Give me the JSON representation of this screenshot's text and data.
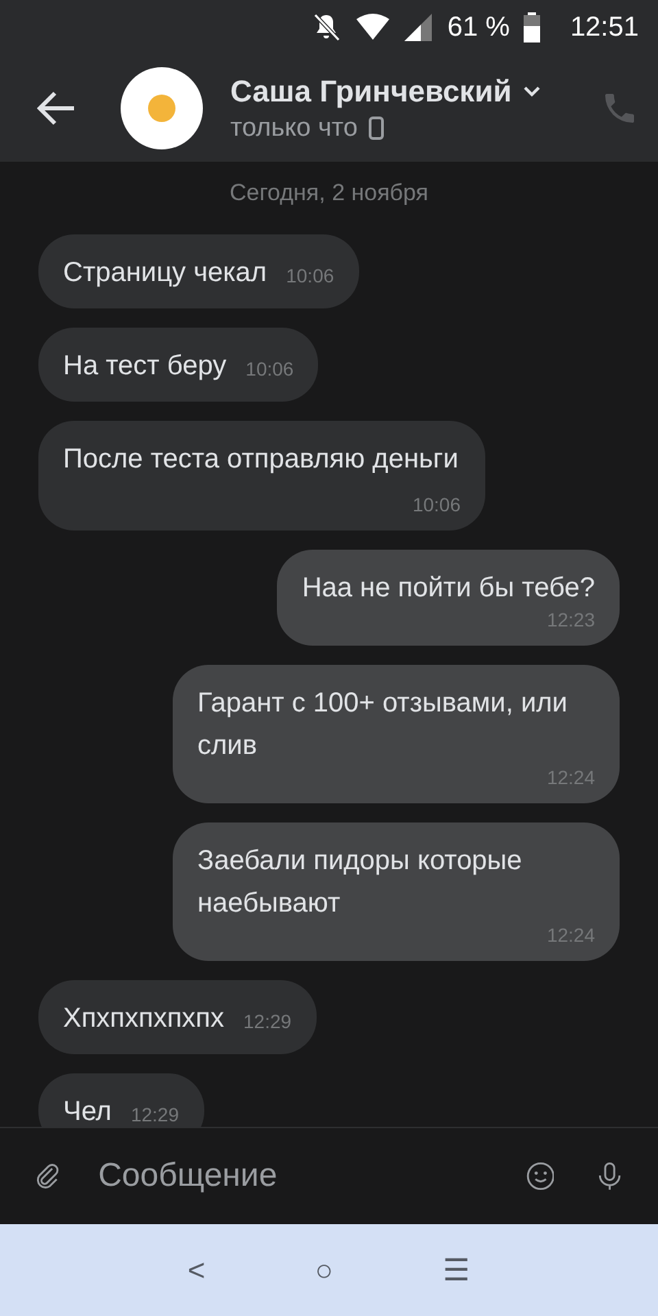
{
  "status_bar": {
    "battery": "61 %",
    "time": "12:51"
  },
  "header": {
    "name": "Саша Гринчевский",
    "status": "только что"
  },
  "date": "Сегодня, 2 ноября",
  "messages": [
    {
      "kind": "in",
      "text": "Страницу чекал",
      "time": "10:06"
    },
    {
      "kind": "in",
      "text": "На тест беру",
      "time": "10:06"
    },
    {
      "kind": "in",
      "text": "После теста отправляю деньги",
      "time": "10:06"
    },
    {
      "kind": "out",
      "text": "Наа не пойти бы тебе?",
      "time": "12:23"
    },
    {
      "kind": "out",
      "text": "Гарант с 100+ отзывами, или слив",
      "time": "12:24"
    },
    {
      "kind": "out",
      "text": "Заебали пидоры которые наебывают",
      "time": "12:24"
    },
    {
      "kind": "in",
      "text": "Хпхпхпхпхпх",
      "time": "12:29"
    },
    {
      "kind": "in",
      "text": "Чел",
      "time": "12:29"
    }
  ],
  "composer": {
    "placeholder": "Сообщение"
  },
  "nav_bar": {
    "back": "<",
    "home": "○",
    "recents": "☰"
  }
}
